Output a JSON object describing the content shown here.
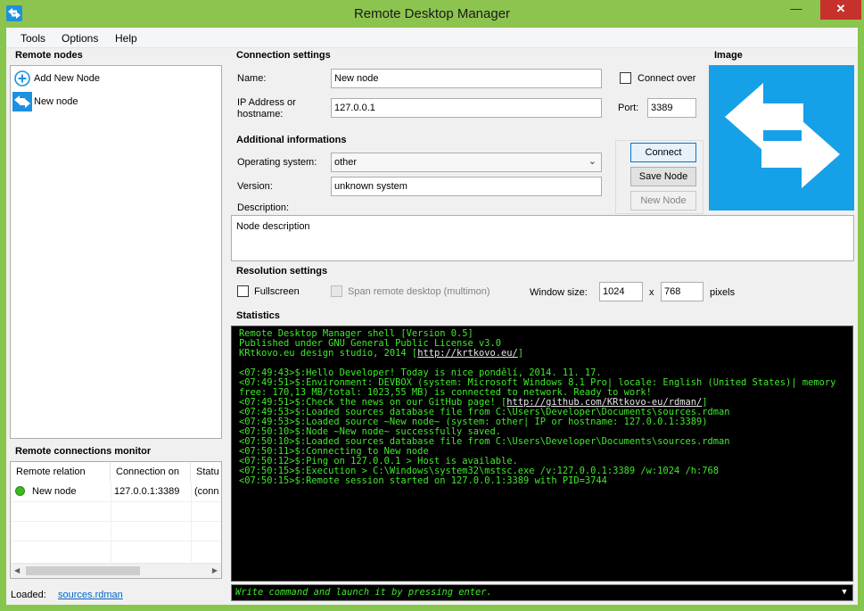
{
  "window": {
    "title": "Remote Desktop Manager",
    "min_glyph": "—",
    "max_glyph": "□",
    "close_glyph": "✕"
  },
  "menu": [
    "Tools",
    "Options",
    "Help"
  ],
  "remote_nodes": {
    "title": "Remote nodes",
    "items": [
      {
        "label": "Add New Node",
        "icon": "add-node-icon"
      },
      {
        "label": "New node",
        "icon": "remote-desktop-icon"
      }
    ]
  },
  "monitor": {
    "title": "Remote connections monitor",
    "columns": [
      "Remote relation",
      "Connection on",
      "Statu"
    ],
    "rows": [
      {
        "name": "New node",
        "connection": "127.0.0.1:3389",
        "status": "(conn",
        "status_color": "#3cb820"
      }
    ]
  },
  "loaded": {
    "label": "Loaded:",
    "file": "sources.rdman"
  },
  "connection_settings": {
    "title": "Connection settings",
    "name_label": "Name:",
    "name_value": "New node",
    "ip_label_1": "IP Address or",
    "ip_label_2": "hostname:",
    "ip_value": "127.0.0.1",
    "connect_over_label": "Connect over",
    "port_label": "Port:",
    "port_value": "3389"
  },
  "image_panel": {
    "title": "Image",
    "icon": "remote-desktop-arrows-icon",
    "color": "#16a0e8"
  },
  "additional": {
    "title": "Additional informations",
    "os_label": "Operating system:",
    "os_value": "other",
    "version_label": "Version:",
    "version_value": "unknown system",
    "description_label": "Description:",
    "description_value": "Node description"
  },
  "buttons": {
    "connect": "Connect",
    "save": "Save Node",
    "new": "New Node"
  },
  "resolution": {
    "title": "Resolution settings",
    "fullscreen_label": "Fullscreen",
    "span_label": "Span remote desktop (multimon)",
    "window_size_label": "Window size:",
    "width": "1024",
    "x_label": "x",
    "height": "768",
    "pixels_label": "pixels"
  },
  "statistics": {
    "title": "Statistics",
    "header": [
      "Remote Desktop Manager shell [Version 0.5]",
      "Published under GNU General Public License v3.0"
    ],
    "studio_prefix": "KRtkovo.eu design studio, 2014 [",
    "studio_link": "http://krtkovo.eu/",
    "studio_suffix": "]",
    "log": [
      "<07:49:43>$:Hello Developer! Today is nice pondělí, 2014. 11. 17.",
      "<07:49:51>$:Environment: DEVBOX (system: Microsoft Windows 8.1 Pro| locale: English (United States)| memory free: 170,13 MB/total: 1023,55 MB) is connected to network. Ready to work!"
    ],
    "github_prefix": "<07:49:51>$:Check the news on our GitHub page! [",
    "github_link": "http://github.com/KRtkovo-eu/rdman/",
    "github_suffix": "]",
    "log2": [
      "<07:49:53>$:Loaded sources database file from C:\\Users\\Developer\\Documents\\sources.rdman",
      "<07:49:53>$:Loaded source ~New node~ (system: other| IP or hostname: 127.0.0.1:3389)",
      "<07:50:10>$:Node ~New node~ successfully saved.",
      "<07:50:10>$:Loaded sources database file from C:\\Users\\Developer\\Documents\\sources.rdman",
      "<07:50:11>$:Connecting to New node",
      "<07:50:12>$:Ping on 127.0.0.1 > Host is available.",
      "<07:50:15>$:Execution > C:\\Windows\\system32\\mstsc.exe /v:127.0.0.1:3389 /w:1024 /h:768",
      "<07:50:15>$:Remote session started on 127.0.0.1:3389 with PID=3744"
    ],
    "command_placeholder": "Write command and launch it by pressing enter.",
    "console_text_color": "#3eea2a"
  },
  "accent": "#86c64c"
}
